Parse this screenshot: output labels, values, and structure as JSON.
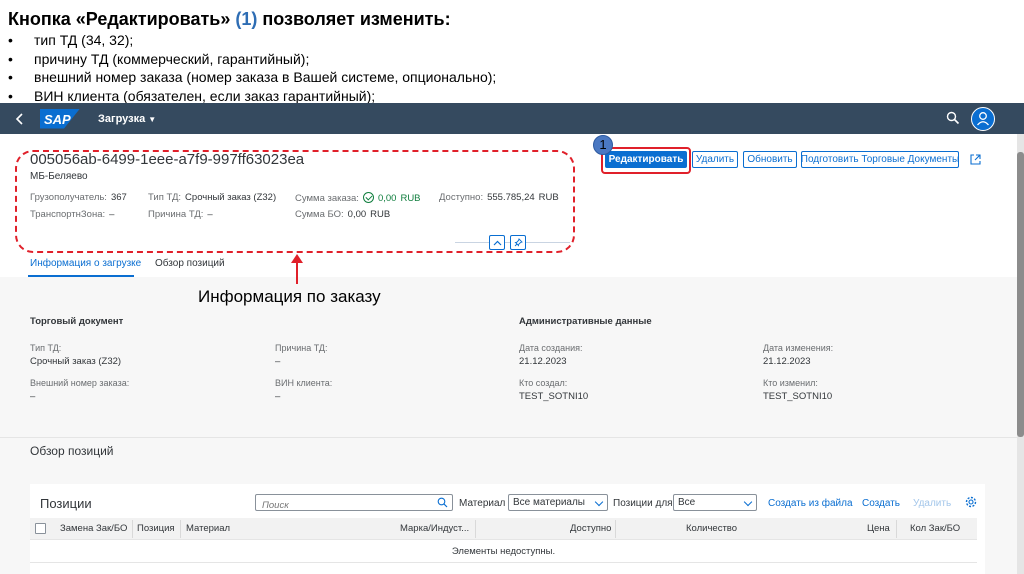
{
  "slide": {
    "title_prefix": "Кнопка «Редактировать» ",
    "title_num": "(1)",
    "title_suffix": " позволяет изменить:",
    "bullets": [
      "тип ТД (34, 32);",
      "причину ТД (коммерческий, гарантийный);",
      "внешний номер заказа (номер заказа в Вашей системе, опционально);",
      "ВИН клиента (обязателен, если заказ гарантийный);"
    ]
  },
  "shell": {
    "logo": "SAP",
    "title": "Загрузка",
    "icons": {
      "back": "back-chevron-icon",
      "search": "search-icon",
      "user": "user-icon"
    }
  },
  "header": {
    "object_id": "005056ab-6499-1eee-a7f9-997ff63023ea",
    "subtitle": "МБ-Беляево",
    "attrs": {
      "consignee_label": "Грузополучатель:",
      "consignee_value": "367",
      "zone_label": "ТранспортнЗона:",
      "zone_value": "–",
      "doc_type_label": "Тип ТД:",
      "doc_type_value": "Срочный заказ (Z32)",
      "reason_label": "Причина ТД:",
      "reason_value": "–",
      "order_sum_label": "Сумма заказа:",
      "order_sum_value": "0,00",
      "order_sum_cur": "RUB",
      "bo_sum_label": "Сумма БО:",
      "bo_sum_value": "0,00",
      "bo_sum_cur": "RUB",
      "available_label": "Доступно:",
      "available_value": "555.785,24",
      "available_cur": "RUB"
    },
    "buttons": {
      "edit": "Редактировать",
      "delete": "Удалить",
      "refresh": "Обновить",
      "prepare": "Подготовить Торговые Документы"
    },
    "annotation_number": "1"
  },
  "tabs": [
    "Информация о загрузке",
    "Обзор позиций"
  ],
  "note": "Информация по заказу",
  "trade_doc": {
    "title": "Торговый документ",
    "doc_type_label": "Тип ТД:",
    "doc_type_value": "Срочный заказ (Z32)",
    "reason_label": "Причина ТД:",
    "reason_value": "–",
    "ext_order_label": "Внешний номер заказа:",
    "ext_order_value": "–",
    "vin_label": "ВИН клиента:",
    "vin_value": "–"
  },
  "admin": {
    "title": "Административные данные",
    "created_label": "Дата создания:",
    "created_value": "21.12.2023",
    "changed_label": "Дата изменения:",
    "changed_value": "21.12.2023",
    "creator_label": "Кто создал:",
    "creator_value": "TEST_SOTNI10",
    "changer_label": "Кто изменил:",
    "changer_value": "TEST_SOTNI10"
  },
  "overview_title": "Обзор позиций",
  "positions": {
    "title": "Позиции",
    "search_placeholder": "Поиск",
    "material_label": "Материал",
    "material_select": "Все материалы",
    "positions_for_label": "Позиции для",
    "positions_for_select": "Все",
    "upload_link": "Создать из файла",
    "create_link": "Создать",
    "delete_link": "Удалить",
    "columns": [
      "Замена Зак/БО",
      "Позиция",
      "Материал",
      "Марка/Индуст...",
      "Доступно",
      "Количество",
      "Цена",
      "Кол Зак/БО"
    ],
    "empty_text": "Элементы недоступны."
  },
  "colors": {
    "shell": "#354a5f",
    "accent": "#0a6ed1",
    "annotation": "#e0202a"
  }
}
